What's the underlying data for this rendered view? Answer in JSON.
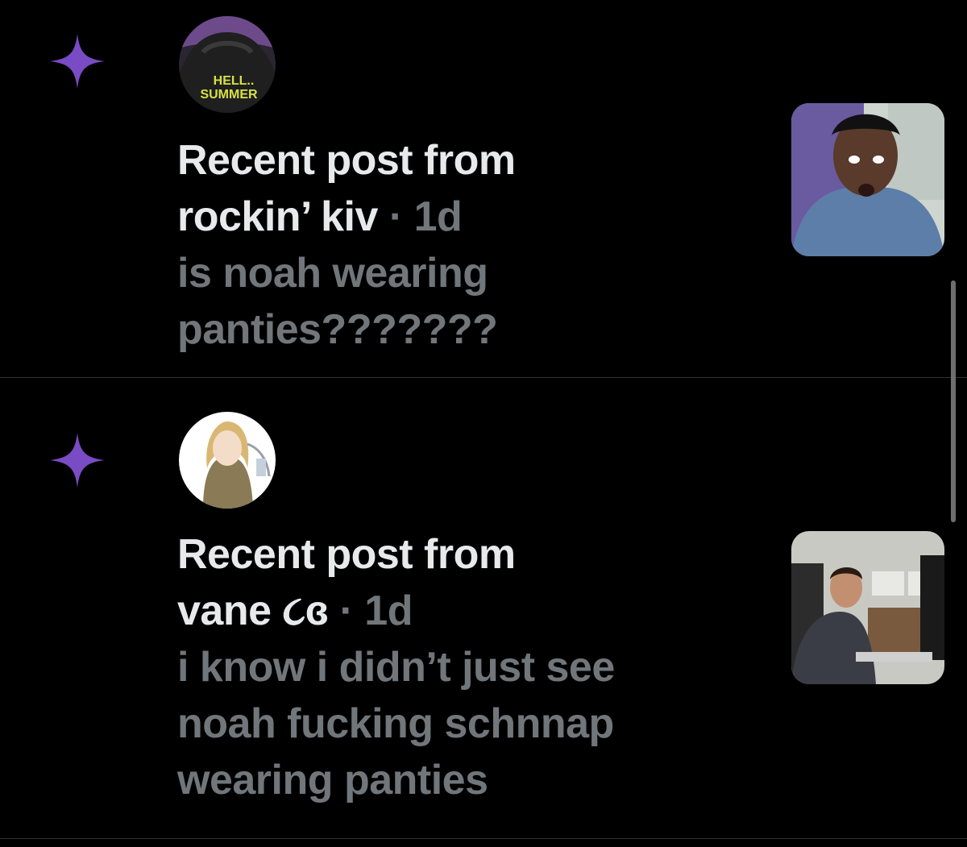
{
  "colors": {
    "accent": "#794BC4",
    "background": "#000000",
    "primary_text": "#e7e9ea",
    "secondary_text": "#71767b",
    "divider": "#2f3336"
  },
  "notifications": [
    {
      "icon": "sparkle-icon",
      "avatar_text": [
        "HELL..",
        "SUMMER"
      ],
      "heading": "Recent post from",
      "author": "rockin’ kiv",
      "time": "· 1d",
      "body_lines": [
        "is noah wearing",
        "panties???????"
      ]
    },
    {
      "icon": "sparkle-icon",
      "heading": "Recent post from",
      "author": "vane",
      "author_emoji": "૮ɞ",
      "time": "· 1d",
      "body_lines": [
        "i know i didn’t just see",
        "noah fucking schnnap",
        "wearing panties"
      ]
    }
  ]
}
